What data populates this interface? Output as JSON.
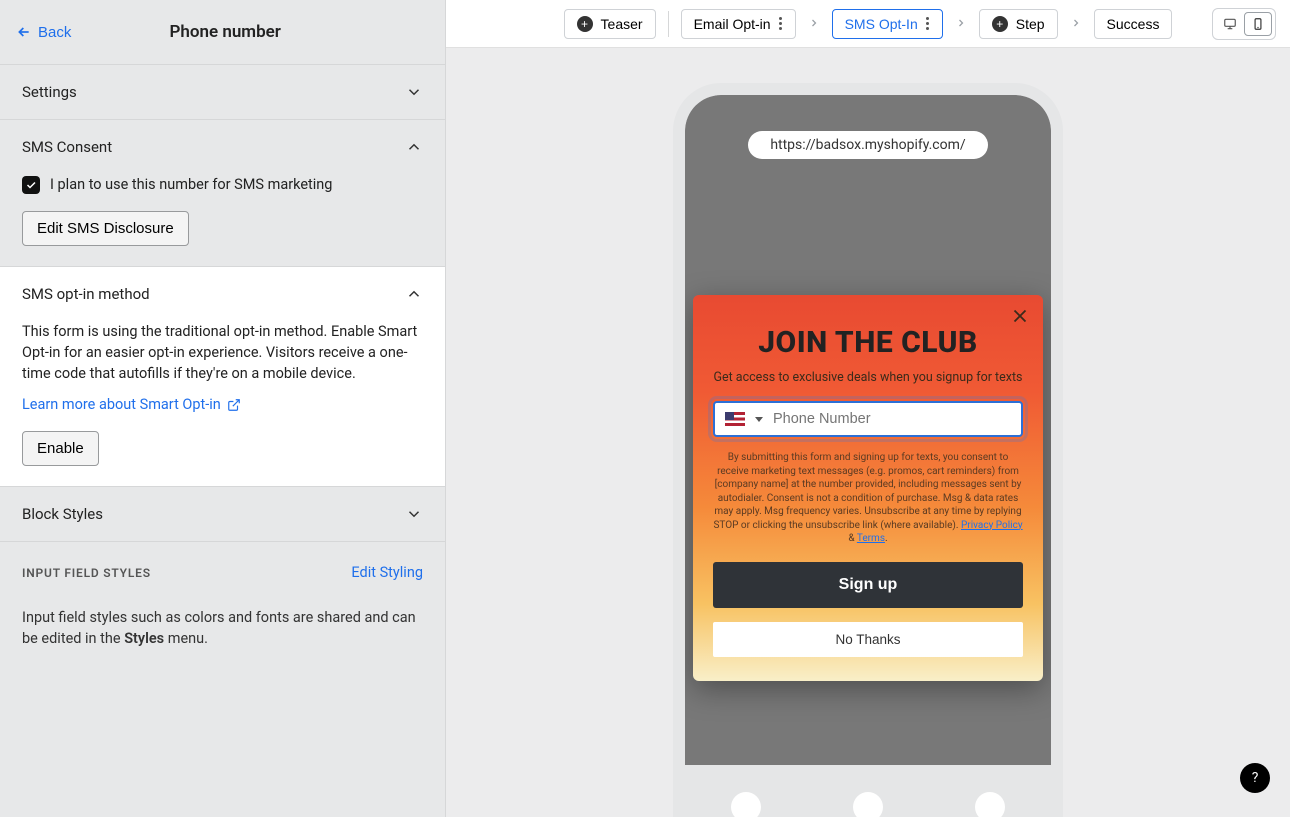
{
  "sidebar": {
    "back_label": "Back",
    "title": "Phone number",
    "sections": {
      "settings": {
        "title": "Settings"
      },
      "sms_consent": {
        "title": "SMS Consent",
        "checkbox_label": "I plan to use this number for SMS marketing",
        "edit_btn": "Edit SMS Disclosure"
      },
      "opt_in": {
        "title": "SMS opt-in method",
        "description": "This form is using the traditional opt-in method. Enable Smart Opt-in for an easier opt-in experience. Visitors receive a one-time code that autofills if they're on a mobile device.",
        "learn_link": "Learn more about Smart Opt-in",
        "enable_btn": "Enable"
      },
      "block_styles": {
        "title": "Block Styles"
      }
    },
    "input_field_styles": {
      "label": "INPUT FIELD STYLES",
      "edit": "Edit Styling",
      "desc_prefix": "Input field styles such as colors and fonts are shared and can be edited in the ",
      "desc_bold": "Styles",
      "desc_suffix": " menu."
    }
  },
  "topbar": {
    "teaser": "Teaser",
    "email_optin": "Email Opt-in",
    "sms_optin": "SMS Opt-In",
    "step": "Step",
    "success": "Success"
  },
  "preview": {
    "url": "https://badsox.myshopify.com/",
    "popup": {
      "title": "JOIN THE CLUB",
      "subtitle": "Get access to exclusive deals when you signup for texts",
      "placeholder": "Phone Number",
      "disclosure_1": "By submitting this form and signing up for texts, you consent to receive marketing text messages (e.g. promos, cart reminders) from [company name] at the number provided, including messages sent by autodialer. Consent is not a condition of purchase. Msg & data rates may apply. Msg frequency varies. Unsubscribe at any time by replying STOP or clicking the unsubscribe link (where available). ",
      "privacy": "Privacy Policy",
      "amp": " & ",
      "terms": "Terms",
      "period": ".",
      "signup": "Sign up",
      "nothanks": "No Thanks"
    }
  },
  "help": "?"
}
